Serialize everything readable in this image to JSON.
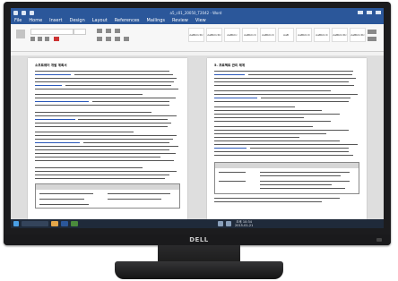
{
  "window": {
    "title": "a5_c01_20050_T2042 - Word",
    "menu": [
      "File",
      "Home",
      "Insert",
      "Design",
      "Layout",
      "References",
      "Mailings",
      "Review",
      "View"
    ]
  },
  "ribbon": {
    "styles": [
      "AaBbCcDc",
      "AaBbCcDc",
      "AaBbCc",
      "AaBbCcC",
      "AaBbCcC",
      "AaB",
      "AaBbCcC",
      "AaBbCcC",
      "AaBbCcDc",
      "AaBbCcDc"
    ]
  },
  "pages": {
    "left_heading": "소프트웨어 개발 계획서",
    "right_heading": "5. 프로젝트 관리 체계"
  },
  "taskbar": {
    "time": "오후 10:34",
    "date": "2015-01-21"
  },
  "brand": "DELL",
  "colors": {
    "title_bar": "#2b579a",
    "taskbar": "#1f2a3a",
    "bezel": "#1c1c1e"
  }
}
